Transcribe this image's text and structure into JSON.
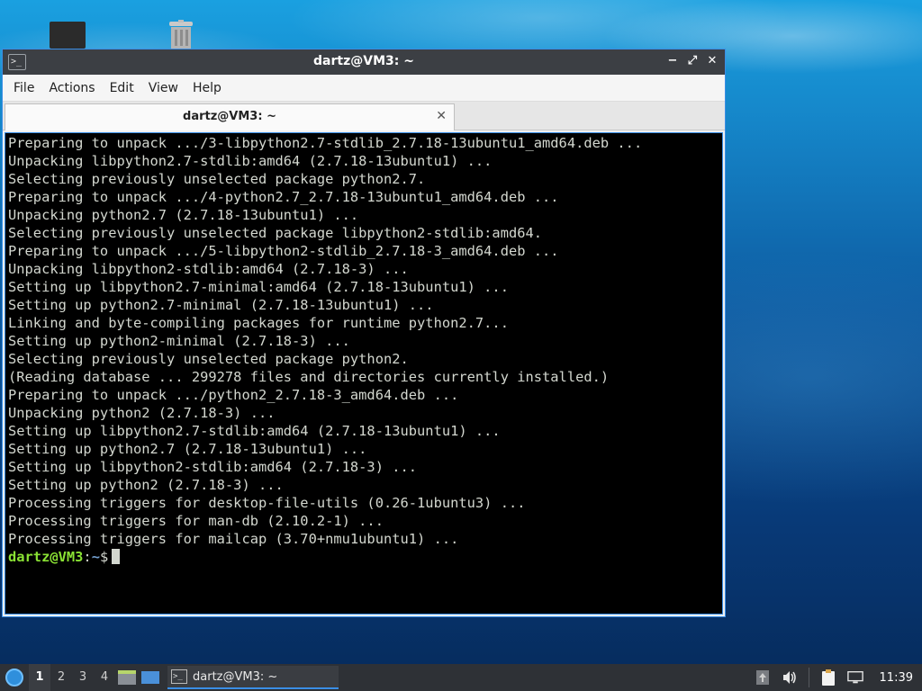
{
  "window": {
    "title": "dartz@VM3: ~",
    "menu": [
      "File",
      "Actions",
      "Edit",
      "View",
      "Help"
    ],
    "tab_label": "dartz@VM3: ~"
  },
  "terminal": {
    "lines": [
      "Preparing to unpack .../3-libpython2.7-stdlib_2.7.18-13ubuntu1_amd64.deb ...",
      "Unpacking libpython2.7-stdlib:amd64 (2.7.18-13ubuntu1) ...",
      "Selecting previously unselected package python2.7.",
      "Preparing to unpack .../4-python2.7_2.7.18-13ubuntu1_amd64.deb ...",
      "Unpacking python2.7 (2.7.18-13ubuntu1) ...",
      "Selecting previously unselected package libpython2-stdlib:amd64.",
      "Preparing to unpack .../5-libpython2-stdlib_2.7.18-3_amd64.deb ...",
      "Unpacking libpython2-stdlib:amd64 (2.7.18-3) ...",
      "Setting up libpython2.7-minimal:amd64 (2.7.18-13ubuntu1) ...",
      "Setting up python2.7-minimal (2.7.18-13ubuntu1) ...",
      "Linking and byte-compiling packages for runtime python2.7...",
      "Setting up python2-minimal (2.7.18-3) ...",
      "Selecting previously unselected package python2.",
      "(Reading database ... 299278 files and directories currently installed.)",
      "Preparing to unpack .../python2_2.7.18-3_amd64.deb ...",
      "Unpacking python2 (2.7.18-3) ...",
      "Setting up libpython2.7-stdlib:amd64 (2.7.18-13ubuntu1) ...",
      "Setting up python2.7 (2.7.18-13ubuntu1) ...",
      "Setting up libpython2-stdlib:amd64 (2.7.18-3) ...",
      "Setting up python2 (2.7.18-3) ...",
      "Processing triggers for desktop-file-utils (0.26-1ubuntu3) ...",
      "Processing triggers for man-db (2.10.2-1) ...",
      "Processing triggers for mailcap (3.70+nmu1ubuntu1) ..."
    ],
    "prompt_user": "dartz@VM3",
    "prompt_sep": ":",
    "prompt_path": "~",
    "prompt_symbol": "$"
  },
  "taskbar": {
    "workspaces": [
      "1",
      "2",
      "3",
      "4"
    ],
    "active_workspace": "1",
    "task_label": "dartz@VM3: ~",
    "clock": "11:39"
  },
  "colors": {
    "prompt_user": "#8ae234",
    "prompt_path": "#729fcf",
    "terminal_bg": "#000000",
    "terminal_fg": "#d3d7cf",
    "accent": "#3a8ee6"
  }
}
